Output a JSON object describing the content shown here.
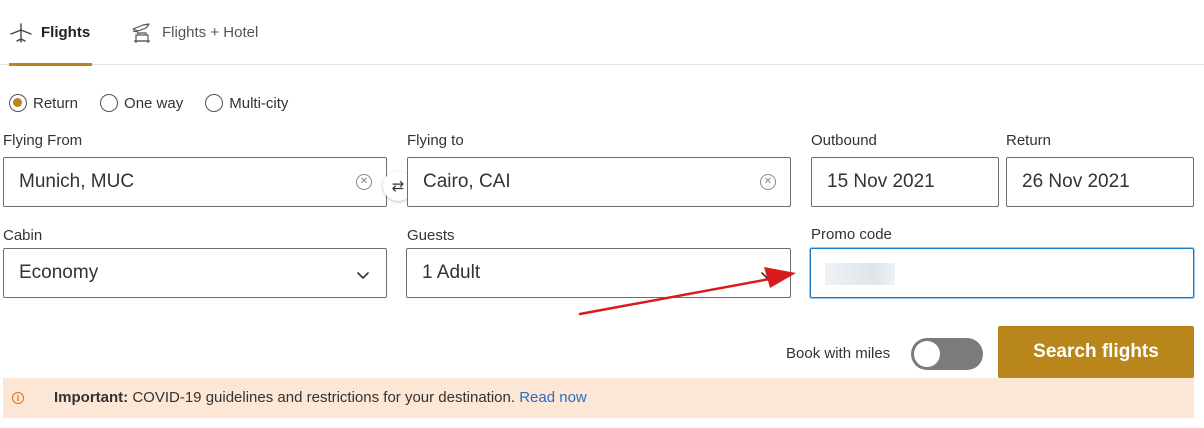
{
  "tabs": [
    {
      "label": "Flights",
      "icon": "airplane-icon",
      "active": true
    },
    {
      "label": "Flights + Hotel",
      "icon": "plane-hotel-icon",
      "active": false
    }
  ],
  "trip_types": [
    {
      "label": "Return",
      "selected": true
    },
    {
      "label": "One way",
      "selected": false
    },
    {
      "label": "Multi-city",
      "selected": false
    }
  ],
  "form": {
    "from": {
      "label": "Flying From",
      "value": "Munich, MUC"
    },
    "to": {
      "label": "Flying to",
      "value": "Cairo, CAI"
    },
    "outbound": {
      "label": "Outbound",
      "value": "15 Nov 2021"
    },
    "return": {
      "label": "Return",
      "value": "26 Nov 2021"
    },
    "cabin": {
      "label": "Cabin",
      "value": "Economy"
    },
    "guests": {
      "label": "Guests",
      "value": "1 Adult"
    },
    "promo": {
      "label": "Promo code",
      "value": ""
    }
  },
  "miles": {
    "label": "Book with miles",
    "enabled": false
  },
  "search_button": "Search flights",
  "notice": {
    "bold": "Important:",
    "text": " COVID-19 guidelines and restrictions for your destination. ",
    "link": "Read now"
  },
  "colors": {
    "accent": "#b8861b",
    "notice_bg": "#fce6d6",
    "link": "#2a6ebf",
    "focus_border": "#1c7ac2",
    "annotation_arrow": "#d61c1c"
  }
}
